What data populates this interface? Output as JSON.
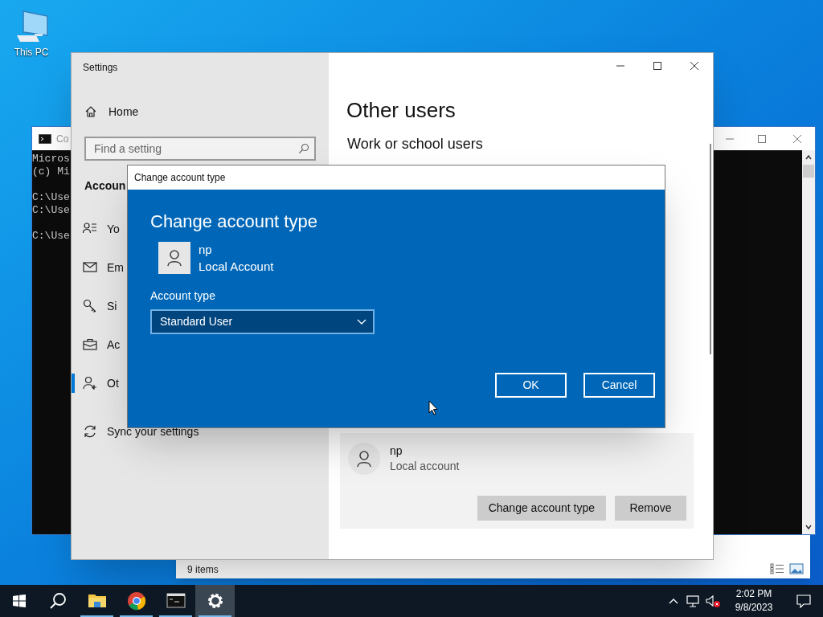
{
  "desktop_icons": [
    {
      "label": "This PC"
    }
  ],
  "explorer_window": {
    "status_text": "9 items"
  },
  "console_window": {
    "title": "Co",
    "paragraphs": [
      [
        "Micros",
        "(c) Mi"
      ],
      [
        "C:\\Use",
        "C:\\Use"
      ],
      [
        "C:\\Use"
      ]
    ]
  },
  "settings_window": {
    "title": "Settings",
    "home": "Home",
    "search_placeholder": "Find a setting",
    "section_heading": "Accoun",
    "nav_items": [
      {
        "kind": "person-list",
        "label": "Yo",
        "selected": false
      },
      {
        "kind": "mail",
        "label": "Em",
        "selected": false
      },
      {
        "kind": "key",
        "label": "Si",
        "selected": false
      },
      {
        "kind": "briefcase",
        "label": "Ac",
        "selected": false
      },
      {
        "kind": "person-add",
        "label": "Ot",
        "selected": true
      },
      {
        "kind": "sync",
        "label": "Sync your settings",
        "selected": false
      }
    ],
    "page_title": "Other users",
    "subheading": "Work or school users",
    "user_card": {
      "name": "np",
      "account_type": "Local account",
      "buttons": [
        "Change account type",
        "Remove"
      ]
    }
  },
  "dialog": {
    "title": "Change account type",
    "heading": "Change account type",
    "user": {
      "name": "np",
      "account_type": "Local Account"
    },
    "field_label": "Account type",
    "field_value": "Standard User",
    "buttons": [
      "OK",
      "Cancel"
    ]
  },
  "taskbar": {
    "apps": [
      {
        "kind": "folder",
        "running": true,
        "selected": false
      },
      {
        "kind": "chrome",
        "running": true,
        "selected": false
      },
      {
        "kind": "console",
        "running": true,
        "selected": false
      },
      {
        "kind": "gear",
        "running": true,
        "selected": true
      }
    ],
    "time": "2:02 PM",
    "date": "9/8/2023"
  }
}
